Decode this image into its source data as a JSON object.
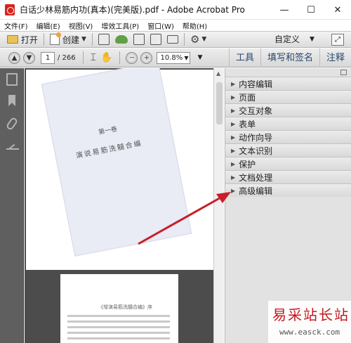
{
  "window": {
    "title": "白话少林易筋内功(真本)(完美版).pdf - Adobe Acrobat Pro",
    "minimize": "—",
    "maximize": "☐",
    "close": "✕"
  },
  "menu": [
    "文件(F)",
    "编辑(E)",
    "视图(V)",
    "增效工具(P)",
    "窗口(W)",
    "帮助(H)"
  ],
  "toolbar": {
    "open_label": "打开",
    "create_label": "创建",
    "customize_label": "自定义"
  },
  "nav": {
    "current_page": "1",
    "total_pages": "/ 266",
    "zoom": "10.8%"
  },
  "tabs": [
    "工具",
    "填写和签名",
    "注释"
  ],
  "panel": {
    "sections": [
      "内容编辑",
      "页面",
      "交互对象",
      "表单",
      "动作向导",
      "文本识别",
      "保护",
      "文档处理",
      "高级编辑"
    ]
  },
  "document": {
    "volume": "第一卷",
    "book_name": "演说易筋洗髓合编",
    "page2_title": "《增演易筋洗髓合编》序"
  },
  "watermark": {
    "name": "易采站长站",
    "url": "www.easck.com"
  },
  "colors": {
    "annotation_arrow": "#c81e28",
    "tab_text": "#27486e",
    "watermark": "#c4171f"
  }
}
